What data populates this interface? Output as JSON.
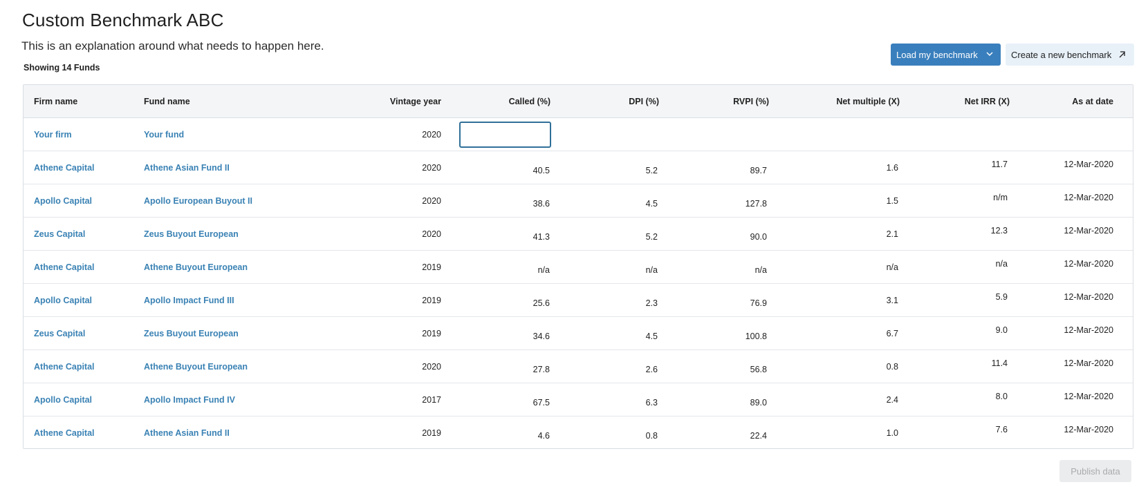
{
  "header": {
    "title": "Custom Benchmark ABC",
    "description": "This is an explanation around what needs to happen here.",
    "count": "Showing 14 Funds"
  },
  "actions": {
    "load_label": "Load my benchmark",
    "create_label": "Create a new benchmark",
    "publish_label": "Publish data"
  },
  "colors": {
    "primary": "#3a7fbd",
    "link": "#3a82b4",
    "secondary_bg": "#e8f1f8",
    "disabled_bg": "#ebeced"
  },
  "table": {
    "columns": [
      "Firm name",
      "Fund name",
      "Vintage year",
      "Called (%)",
      "DPI (%)",
      "RVPI (%)",
      "Net multiple (X)",
      "Net IRR (X)",
      "As at date"
    ],
    "input_row": {
      "firm": "Your firm",
      "fund": "Your fund",
      "vintage": "2020",
      "called_value": ""
    },
    "rows": [
      {
        "firm": "Athene Capital",
        "fund": "Athene Asian Fund II",
        "vintage": "2020",
        "called": "40.5",
        "dpi": "5.2",
        "rvpi": "89.7",
        "multiple": "1.6",
        "irr": "11.7",
        "date": "12-Mar-2020"
      },
      {
        "firm": "Apollo Capital",
        "fund": "Apollo European Buyout II",
        "vintage": "2020",
        "called": "38.6",
        "dpi": "4.5",
        "rvpi": "127.8",
        "multiple": "1.5",
        "irr": "n/m",
        "date": "12-Mar-2020"
      },
      {
        "firm": "Zeus Capital",
        "fund": "Zeus Buyout European",
        "vintage": "2020",
        "called": "41.3",
        "dpi": "5.2",
        "rvpi": "90.0",
        "multiple": "2.1",
        "irr": "12.3",
        "date": "12-Mar-2020"
      },
      {
        "firm": "Athene Capital",
        "fund": "Athene Buyout European",
        "vintage": "2019",
        "called": "n/a",
        "dpi": "n/a",
        "rvpi": "n/a",
        "multiple": "n/a",
        "irr": "n/a",
        "date": "12-Mar-2020"
      },
      {
        "firm": "Apollo Capital",
        "fund": "Apollo Impact Fund III",
        "vintage": "2019",
        "called": "25.6",
        "dpi": "2.3",
        "rvpi": "76.9",
        "multiple": "3.1",
        "irr": "5.9",
        "date": "12-Mar-2020"
      },
      {
        "firm": "Zeus Capital",
        "fund": "Zeus Buyout European",
        "vintage": "2019",
        "called": "34.6",
        "dpi": "4.5",
        "rvpi": "100.8",
        "multiple": "6.7",
        "irr": "9.0",
        "date": "12-Mar-2020"
      },
      {
        "firm": "Athene Capital",
        "fund": "Athene Buyout European",
        "vintage": "2020",
        "called": "27.8",
        "dpi": "2.6",
        "rvpi": "56.8",
        "multiple": "0.8",
        "irr": "11.4",
        "date": "12-Mar-2020"
      },
      {
        "firm": "Apollo Capital",
        "fund": "Apollo Impact Fund IV",
        "vintage": "2017",
        "called": "67.5",
        "dpi": "6.3",
        "rvpi": "89.0",
        "multiple": "2.4",
        "irr": "8.0",
        "date": "12-Mar-2020"
      },
      {
        "firm": "Athene Capital",
        "fund": "Athene Asian Fund II",
        "vintage": "2019",
        "called": "4.6",
        "dpi": "0.8",
        "rvpi": "22.4",
        "multiple": "1.0",
        "irr": "7.6",
        "date": "12-Mar-2020"
      }
    ]
  }
}
